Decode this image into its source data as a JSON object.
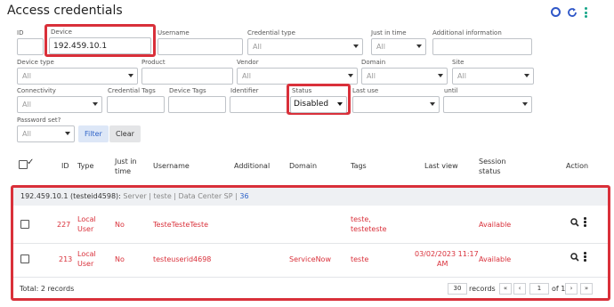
{
  "page": {
    "title": "Access credentials"
  },
  "filters": {
    "id_label": "ID",
    "device_label": "Device",
    "device_value": "192.459.10.1",
    "username_label": "Username",
    "credential_type_label": "Credential type",
    "credential_type_value": "All",
    "just_in_time_label": "Just in time",
    "just_in_time_value": "All",
    "additional_info_label": "Additional information",
    "device_type_label": "Device type",
    "device_type_value": "All",
    "product_label": "Product",
    "vendor_label": "Vendor",
    "vendor_value": "All",
    "domain_label": "Domain",
    "domain_value": "All",
    "site_label": "Site",
    "site_value": "All",
    "connectivity_label": "Connectivity",
    "connectivity_value": "All",
    "credential_tags_label": "Credential Tags",
    "device_tags_label": "Device Tags",
    "identifier_label": "Identifier",
    "status_label": "Status",
    "status_value": "Disabled",
    "last_use_label": "Last use",
    "until_label": "until",
    "password_set_label": "Password set?",
    "password_set_value": "All",
    "filter_button": "Filter",
    "clear_button": "Clear"
  },
  "table": {
    "columns": {
      "id": "ID",
      "type": "Type",
      "just_in_time_1": "Just in",
      "just_in_time_2": "time",
      "username": "Username",
      "additional": "Additional",
      "domain": "Domain",
      "tags": "Tags",
      "last_view": "Last view",
      "session_status_1": "Session",
      "session_status_2": "status",
      "action": "Action"
    },
    "group": {
      "device": "192.459.10.1 (testeid4598):",
      "server": "Server",
      "sep1": "|",
      "site": "teste",
      "sep2": "|",
      "datacenter": "Data Center SP",
      "sep3": "|",
      "count": "36"
    },
    "rows": [
      {
        "id": "227",
        "type_1": "Local",
        "type_2": "User",
        "just_in_time": "No",
        "username": "TesteTesteTeste",
        "additional": "",
        "domain": "",
        "tags_1": "teste,",
        "tags_2": "testeteste",
        "last_view_1": "",
        "last_view_2": "",
        "session_status": "Available"
      },
      {
        "id": "213",
        "type_1": "Local",
        "type_2": "User",
        "just_in_time": "No",
        "username": "testeuserid4698",
        "additional": "",
        "domain": "ServiceNow",
        "tags_1": "teste",
        "tags_2": "",
        "last_view_1": "03/02/2023 11:17",
        "last_view_2": "AM",
        "session_status": "Available"
      }
    ],
    "total": "Total: 2 records",
    "pagination": {
      "per_page": "30",
      "records_label": "records",
      "first": "«",
      "prev": "‹",
      "page": "1",
      "of_label": "of 1",
      "next": "›",
      "last": "»"
    }
  },
  "colors": {
    "highlight_red": "#d9303a",
    "accent_blue": "#2f57c8",
    "accent_teal": "#17a589"
  }
}
